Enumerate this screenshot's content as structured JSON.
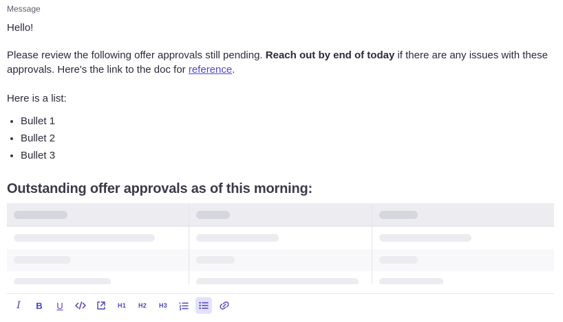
{
  "field": {
    "label": "Message"
  },
  "message": {
    "greeting": "Hello!",
    "body_intro": "Please review the following offer approvals still pending. ",
    "body_bold": "Reach out by end of today",
    "body_after": " if there are any issues with these approvals. Here's the link to the doc for ",
    "link_text": "reference",
    "body_end": ".",
    "list_intro": "Here is a list:",
    "bullets": [
      "Bullet 1",
      "Bullet 2",
      "Bullet 3"
    ]
  },
  "table_block": {
    "heading": "Outstanding offer approvals as of this morning:",
    "loading": true
  },
  "toolbar": {
    "italic": "I",
    "bold": "B",
    "underline": "U",
    "h1": "H1",
    "h2": "H2",
    "h3": "H3",
    "active_button": "bulleted-list",
    "icons": [
      "italic-icon",
      "bold-icon",
      "underline-icon",
      "code-icon",
      "embed-icon",
      "heading-1-icon",
      "heading-2-icon",
      "heading-3-icon",
      "numbered-list-icon",
      "bulleted-list-icon",
      "link-icon"
    ]
  },
  "colors": {
    "accent": "#4a44b8",
    "active_bg": "#e4e2f8",
    "link": "#4f46c8",
    "skeleton": "#ececf0",
    "table_header_bg": "#ededf1"
  }
}
